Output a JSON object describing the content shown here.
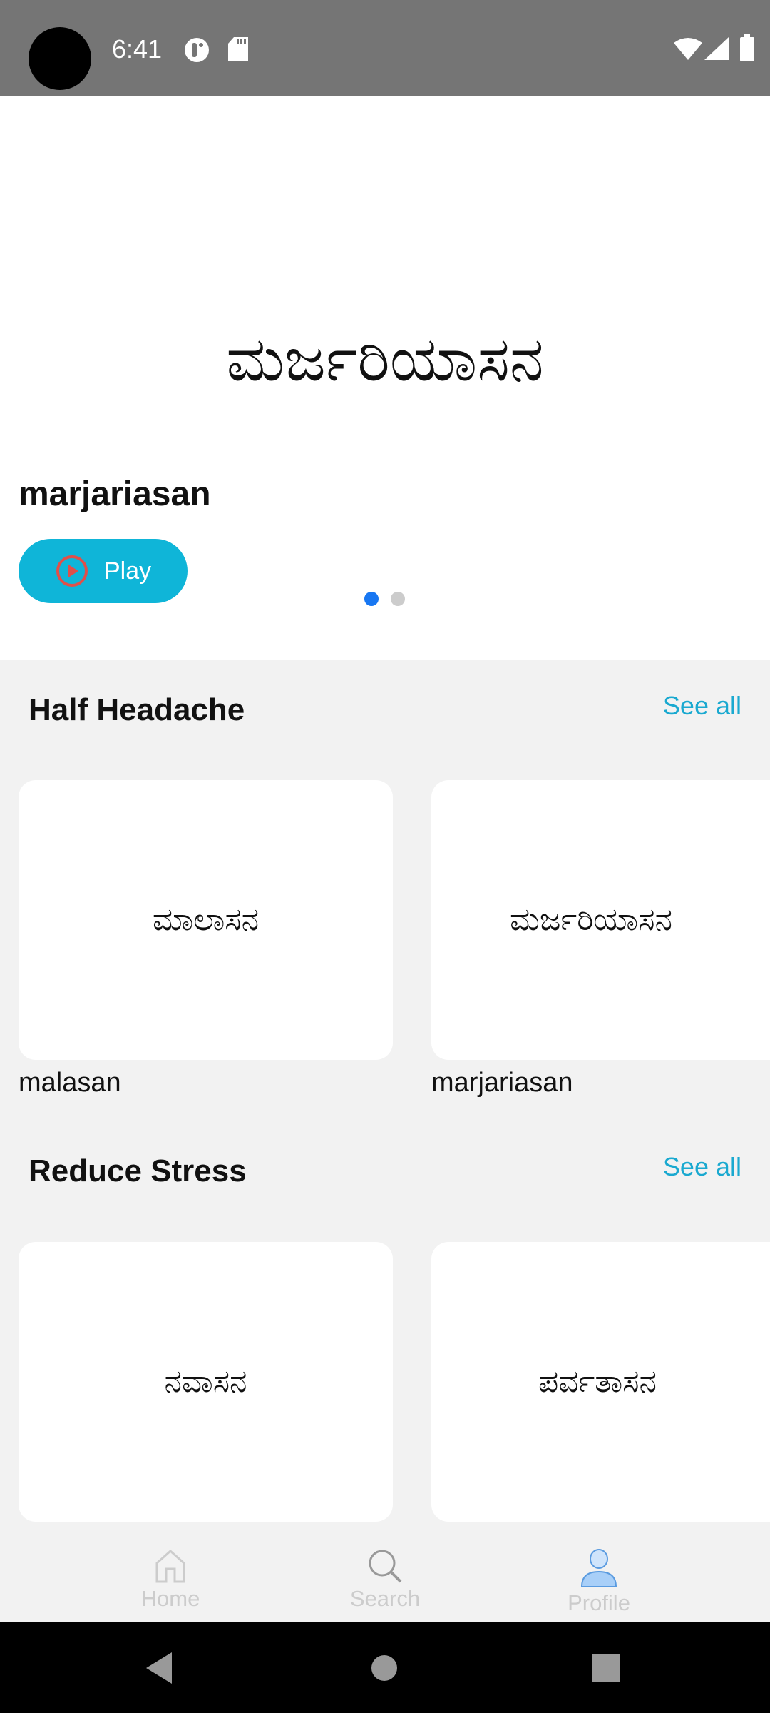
{
  "status_bar": {
    "time": "6:41",
    "icons": [
      "camera-cutout",
      "data-saver-icon",
      "sd-card-icon",
      "wifi-icon",
      "signal-icon",
      "battery-icon"
    ]
  },
  "hero": {
    "title": "ಮರ್ಜರಿಯಾಸನ",
    "name": "marjariasan",
    "play_label": "Play",
    "page_count": 2,
    "active_page": 1,
    "accent": "#0fb5d8"
  },
  "sections": [
    {
      "title": "Half Headache",
      "see_all": "See all",
      "items": [
        {
          "kannada": "ಮಾಲಾಸನ",
          "name": "malasan"
        },
        {
          "kannada": "ಮರ್ಜರಿಯಾಸನ",
          "name": "marjariasan"
        }
      ]
    },
    {
      "title": "Reduce Stress",
      "see_all": "See all",
      "items": [
        {
          "kannada": "ನವಾಸನ"
        },
        {
          "kannada": "ಪರ್ವತಾಸನ"
        }
      ]
    }
  ],
  "bottom_nav": {
    "items": [
      {
        "label": "Home",
        "icon": "home-icon"
      },
      {
        "label": "Search",
        "icon": "search-icon"
      },
      {
        "label": "Profile",
        "icon": "profile-icon",
        "active": true
      }
    ]
  },
  "system_nav": [
    "back",
    "home",
    "recents"
  ]
}
